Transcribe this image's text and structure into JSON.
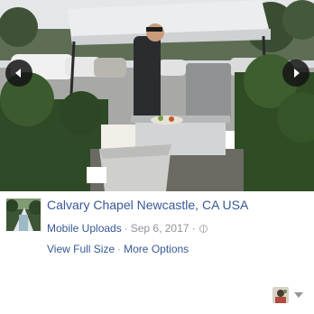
{
  "photo": {
    "alt": "Man grilling under a canopy in a parking lot",
    "prev_icon": "chevron-left-icon",
    "next_icon": "chevron-right-icon"
  },
  "post": {
    "place_title": "Calvary Chapel Newcastle, CA USA",
    "album_link": "Mobile Uploads",
    "separator": "·",
    "date": "Sep 6, 2017",
    "date_separator": "·",
    "privacy_icon": "globe-icon"
  },
  "actions": {
    "view_full_size": "View Full Size",
    "separator": "·",
    "more_options": "More Options"
  },
  "viewer": {
    "avatar_icon": "profile-avatar",
    "caret_icon": "caret-down-icon"
  },
  "colors": {
    "link": "#365899",
    "meta": "#90949c",
    "arrow_bg": "#141414"
  }
}
